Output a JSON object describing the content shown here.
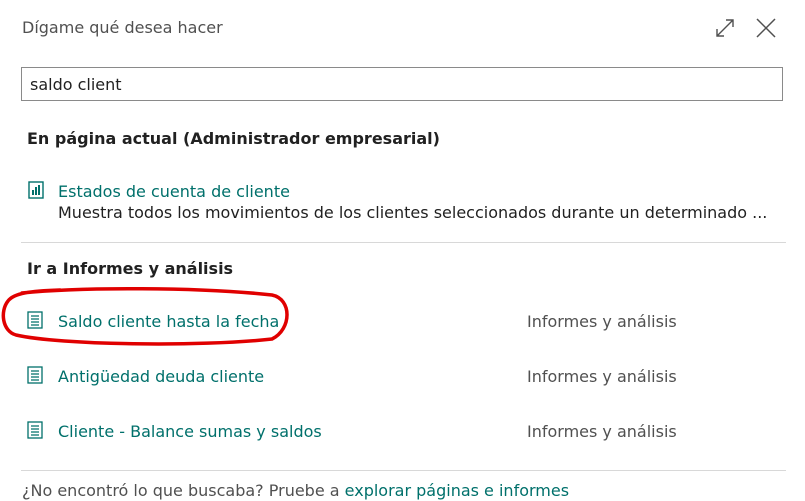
{
  "dialog": {
    "title": "Dígame qué desea hacer"
  },
  "search": {
    "value": "saldo client"
  },
  "sections": [
    {
      "header": "En página actual (Administrador empresarial)",
      "items": [
        {
          "label": "Estados de cuenta de cliente",
          "description": "Muestra todos los movimientos de los clientes seleccionados durante un determinado ...",
          "icon": "report-chart-icon"
        }
      ]
    },
    {
      "header": "Ir a Informes y análisis",
      "items": [
        {
          "label": "Saldo cliente hasta la fecha",
          "category": "Informes y análisis",
          "icon": "report-icon"
        },
        {
          "label": "Antigüedad deuda cliente",
          "category": "Informes y análisis",
          "icon": "report-icon"
        },
        {
          "label": "Cliente - Balance sumas y saldos",
          "category": "Informes y análisis",
          "icon": "report-icon"
        }
      ]
    }
  ],
  "footer": {
    "prefix": "¿No encontró lo que buscaba? Pruebe a ",
    "link": "explorar páginas e informes"
  },
  "colors": {
    "link": "#00706b",
    "annotation": "#e00000"
  }
}
